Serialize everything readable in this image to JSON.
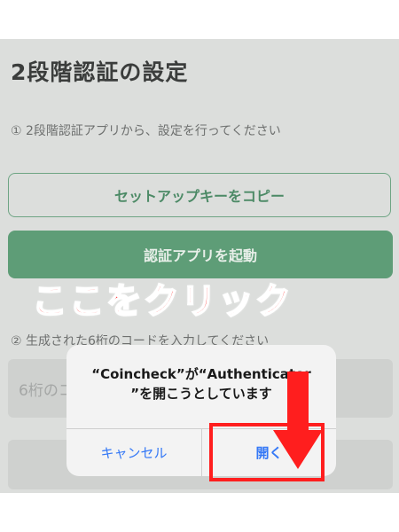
{
  "header": {
    "title": "2段階認証の設定"
  },
  "step1": {
    "text": "① 2段階認証アプリから、設定を行ってください"
  },
  "buttons": {
    "copy_key": "セットアップキーをコピー",
    "launch_app": "認証アプリを起動"
  },
  "step2": {
    "text": "② 生成された6桁のコードを入力してください"
  },
  "code_input": {
    "placeholder": "6桁のコード"
  },
  "annotation": {
    "callout": "ここをクリック",
    "color": "#ff1e1e"
  },
  "dialog": {
    "line1": "“Coincheck”が“Authenticator",
    "line2": "”を開こうとしています",
    "cancel": "キャンセル",
    "open": "開く"
  },
  "colors": {
    "accent": "#5e9d77",
    "link_blue": "#3478f6"
  }
}
